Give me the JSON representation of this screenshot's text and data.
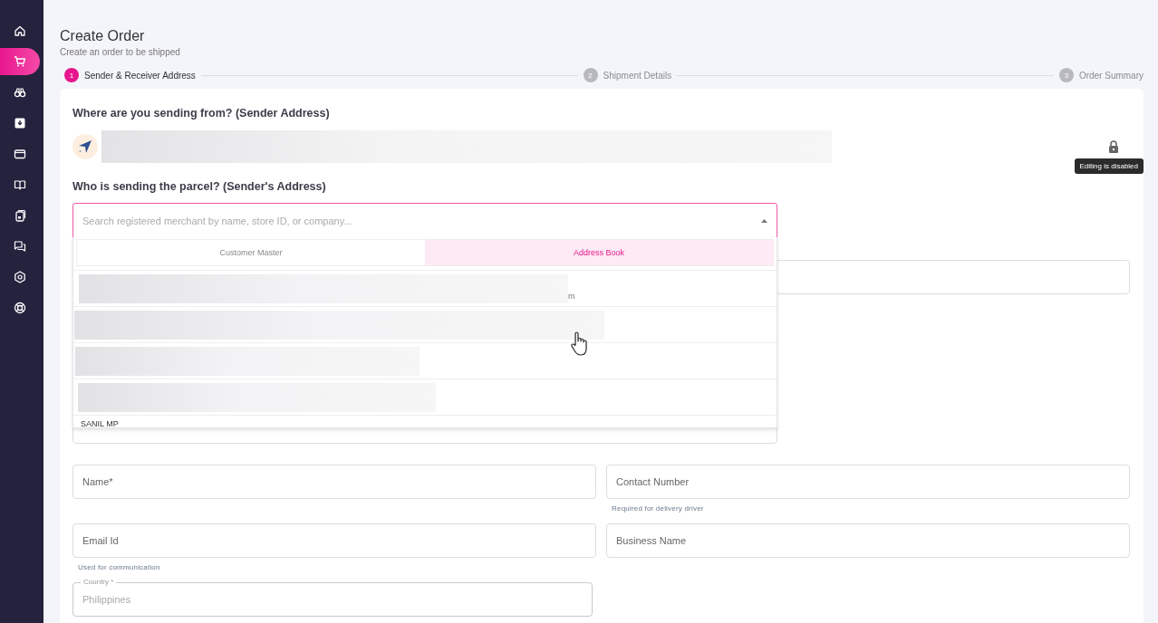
{
  "sidebar": {
    "items": [
      {
        "selected": false
      },
      {
        "selected": true
      },
      {
        "selected": false
      },
      {
        "selected": false
      },
      {
        "selected": false
      },
      {
        "selected": false
      },
      {
        "selected": false
      },
      {
        "selected": false
      },
      {
        "selected": false
      },
      {
        "selected": false
      }
    ]
  },
  "page": {
    "title": "Create Order",
    "subtitle": "Create an order to be shipped"
  },
  "stepper": [
    {
      "number": "1",
      "label": "Sender & Receiver Address",
      "selected": true
    },
    {
      "number": "2",
      "label": "Shipment Details",
      "selected": false
    },
    {
      "number": "3",
      "label": "Order Summary",
      "selected": false
    }
  ],
  "sender_location": {
    "heading": "Where are you sending from? (Sender Address)",
    "locked": true,
    "tooltip": "Editing is disabled"
  },
  "sender_search": {
    "heading": "Who is sending the parcel? (Sender's Address)",
    "placeholder": "Search registered merchant by name, store ID, or company...",
    "expanded": true,
    "tabs": [
      {
        "label": "Customer Master",
        "selected": false
      },
      {
        "label": "Address Book",
        "selected": true
      }
    ],
    "results": [
      {
        "kind": "redacted",
        "tail": "m"
      },
      {
        "kind": "redacted"
      },
      {
        "kind": "redacted"
      },
      {
        "kind": "redacted"
      },
      {
        "kind": "text",
        "name": "SANIL  MP"
      }
    ]
  },
  "form_fields": [
    {
      "placeholder": "Name*"
    },
    {
      "placeholder": "Contact Number",
      "helper": "Required for delivery driver"
    },
    {
      "placeholder": "Email Id",
      "helper": "Used for communication"
    },
    {
      "placeholder": "Business Name"
    },
    {
      "label": "Country *",
      "value": "Philippines",
      "disabled": true
    }
  ]
}
